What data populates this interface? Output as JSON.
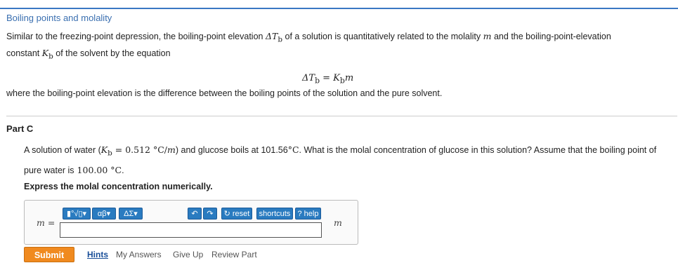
{
  "title": "Boiling points and molality",
  "intro": {
    "line1_pre": "Similar to the freezing-point depression, the boiling-point elevation",
    "line1_sym1": "ΔT",
    "line1_sub1": "b",
    "line1_mid": "of a solution is quantitatively related to the molality",
    "line1_sym2": "m",
    "line1_post": "and the boiling-point-elevation",
    "line2_pre": "constant",
    "line2_sym": "K",
    "line2_sub": "b",
    "line2_post": "of the solvent by the equation"
  },
  "equation": {
    "lhs": "ΔT",
    "lhs_sub": "b",
    "op": " = ",
    "rhs": "K",
    "rhs_sub": "b",
    "rhs_m": "m"
  },
  "where_text": "where the boiling-point elevation is the difference between the boiling points of the solution and the pure solvent.",
  "part_label": "Part C",
  "question": {
    "pre": "A solution of water (",
    "k": "K",
    "k_sub": "b",
    "k_val": " = 0.512 °C/",
    "k_m": "m",
    "mid": ") and glucose boils at 101.56",
    "deg": "°C",
    "post": ". What is the molal concentration of glucose in this solution? Assume that the boiling point of pure water is",
    "water_bp": " 100.00 °C",
    "end": "."
  },
  "instruction": "Express the molal concentration numerically.",
  "answer": {
    "var_label": "m =",
    "unit": "m",
    "input_value": "",
    "toolbar": {
      "templates": "▮°√▯▾",
      "greek": "αβ▾",
      "symbols": "ΔΣ▾",
      "undo": "↶",
      "redo": "↷",
      "reset": "↻ reset",
      "shortcuts": "shortcuts",
      "help": "? help"
    }
  },
  "actions": {
    "submit": "Submit",
    "hints": "Hints",
    "my_answers": "My Answers",
    "give_up": "Give Up",
    "review_part": "Review Part"
  },
  "colors": {
    "accent": "#3a78c3",
    "submit": "#f08a1f",
    "toolbar": "#2a7bc0"
  }
}
